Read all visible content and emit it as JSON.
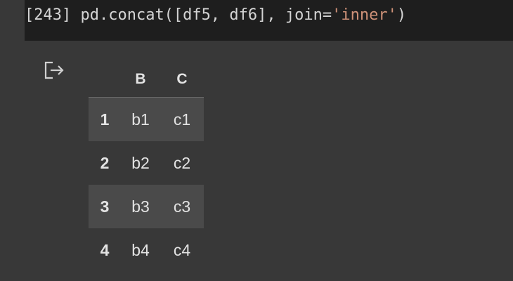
{
  "code_cell": {
    "execution_count": "[243]",
    "code_before_string": " pd.concat([df5, df6], join=",
    "code_string": "'inner'",
    "code_after_string": ")"
  },
  "output": {
    "icon": "output-redirect-icon",
    "table": {
      "columns": [
        "",
        "B",
        "C"
      ],
      "rows": [
        {
          "index": "1",
          "B": "b1",
          "C": "c1"
        },
        {
          "index": "2",
          "B": "b2",
          "C": "c2"
        },
        {
          "index": "3",
          "B": "b3",
          "C": "c3"
        },
        {
          "index": "4",
          "B": "b4",
          "C": "c4"
        }
      ]
    }
  },
  "colors": {
    "background": "#383838",
    "code_background": "#1e1e1e",
    "string_color": "#ce9178",
    "striped_row": "#4a4a4a"
  }
}
